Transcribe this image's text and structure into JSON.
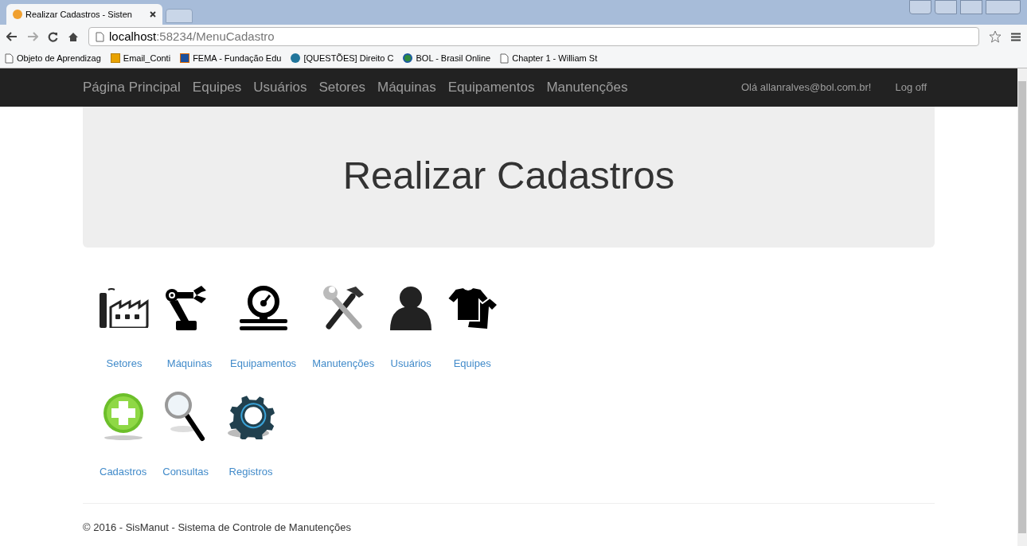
{
  "browser": {
    "tab_title": "Realizar Cadastros - Sisten",
    "address": {
      "host": "localhost",
      "path": ":58234/MenuCadastro"
    },
    "bookmarks": [
      "Objeto de Aprendizag",
      "Email_Conti",
      "FEMA - Fundação Edu",
      "[QUESTÕES] Direito C",
      "BOL - Brasil Online",
      "Chapter 1 - William St"
    ]
  },
  "navbar": {
    "items": [
      "Página Principal",
      "Equipes",
      "Usuários",
      "Setores",
      "Máquinas",
      "Equipamentos",
      "Manutenções"
    ],
    "greeting": "Olá allanralves@bol.com.br!",
    "logoff": "Log off"
  },
  "jumbotron": {
    "title": "Realizar Cadastros"
  },
  "tile_rows": [
    [
      "Setores",
      "Máquinas",
      "Equipamentos",
      "Manutenções",
      "Usuários",
      "Equipes"
    ],
    [
      "Cadastros",
      "Consultas",
      "Registros"
    ]
  ],
  "footer": "© 2016 - SisManut - Sistema de Controle de Manutenções"
}
